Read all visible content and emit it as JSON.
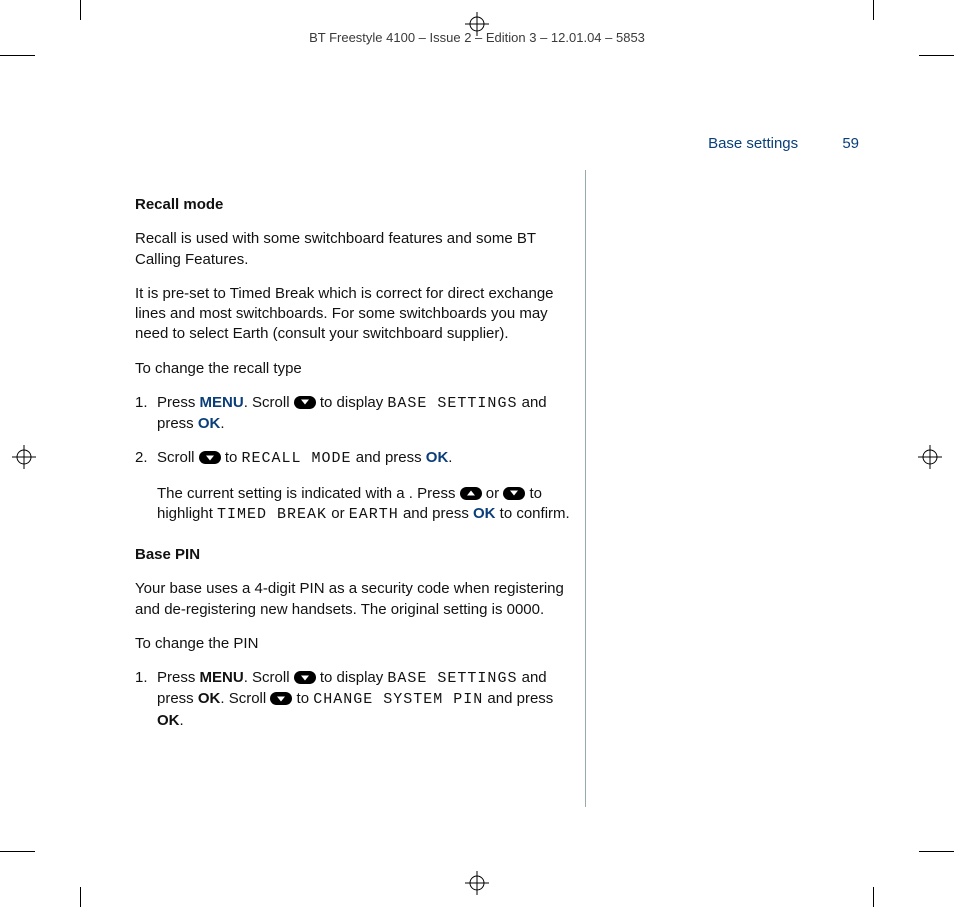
{
  "header": "BT Freestyle 4100 – Issue 2 – Edition 3 – 12.01.04 – 5853",
  "running_head": {
    "section": "Base settings",
    "page": "59"
  },
  "recall": {
    "title": "Recall mode",
    "intro": "Recall is used with some switchboard features and some BT Calling Features.",
    "preset": "It is pre-set to Timed Break which is correct for direct exchange lines and most switchboards.  For some switchboards you may need to select Earth (consult your switchboard supplier).",
    "sub": "To change the recall type",
    "s1_a": "Press ",
    "s1_menu": "MENU",
    "s1_b": ". Scroll ",
    "s1_c": " to display ",
    "s1_lcd": "BASE SETTINGS",
    "s1_d": " and press ",
    "s1_ok": "OK",
    "s1_e": ".",
    "s2_a": "Scroll ",
    "s2_b": " to ",
    "s2_lcd": "RECALL MODE",
    "s2_c": " and press ",
    "s2_ok": "OK",
    "s2_d": ".",
    "s2_p2a": "The current setting is indicated with a    . Press ",
    "s2_p2b": " or ",
    "s2_p2c": " to highlight ",
    "s2_lcd2": "TIMED BREAK",
    "s2_or": " or ",
    "s2_lcd3": "EARTH",
    "s2_p2d": " and press ",
    "s2_ok2": "OK",
    "s2_p2e": " to confirm."
  },
  "pin": {
    "title": "Base PIN",
    "intro": "Your base uses a 4-digit PIN as a security code when registering and de-registering new handsets. The original setting is 0000.",
    "sub": "To change the PIN",
    "s1_a": "Press ",
    "s1_menu": "MENU",
    "s1_b": ". Scroll ",
    "s1_c": " to display ",
    "s1_lcd": "BASE SETTINGS",
    "s1_d": " and press ",
    "s1_ok": "OK",
    "s1_e": ". Scroll ",
    "s1_f": " to ",
    "s1_lcd2": "CHANGE SYSTEM PIN",
    "s1_g": " and press ",
    "s1_ok2": "OK",
    "s1_h": "."
  }
}
